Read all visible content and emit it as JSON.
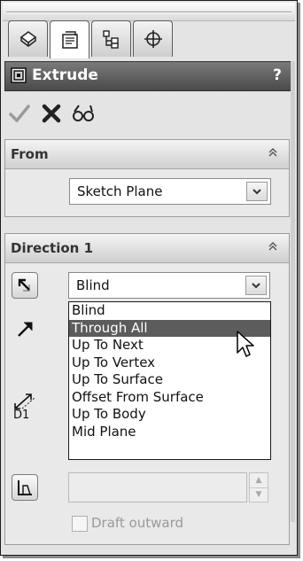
{
  "panel": {
    "tabs": [
      {
        "icon": "feature-manager-icon"
      },
      {
        "icon": "property-manager-icon"
      },
      {
        "icon": "configuration-manager-icon"
      },
      {
        "icon": "dimxpert-icon"
      }
    ],
    "title": "Extrude",
    "help_label": "?",
    "actions": [
      {
        "icon": "ok-checkmark-icon"
      },
      {
        "icon": "cancel-x-icon"
      },
      {
        "icon": "detailed-preview-icon"
      }
    ]
  },
  "from_group": {
    "title": "From",
    "start_condition": "Sketch Plane"
  },
  "direction1_group": {
    "title": "Direction 1",
    "end_condition": "Blind",
    "end_condition_options": [
      "Blind",
      "Through All",
      "Up To Next",
      "Up To Vertex",
      "Up To Surface",
      "Offset From Surface",
      "Up To Body",
      "Mid Plane"
    ],
    "highlighted_option": "Through All",
    "depth_label": "D1",
    "depth_value": "",
    "draft_outward_label": "Draft outward",
    "draft_outward_checked": false
  },
  "colors": {
    "title_bar": "#5c5c5c",
    "highlight": "#5c5c5c",
    "background": "#e4e4e4"
  }
}
